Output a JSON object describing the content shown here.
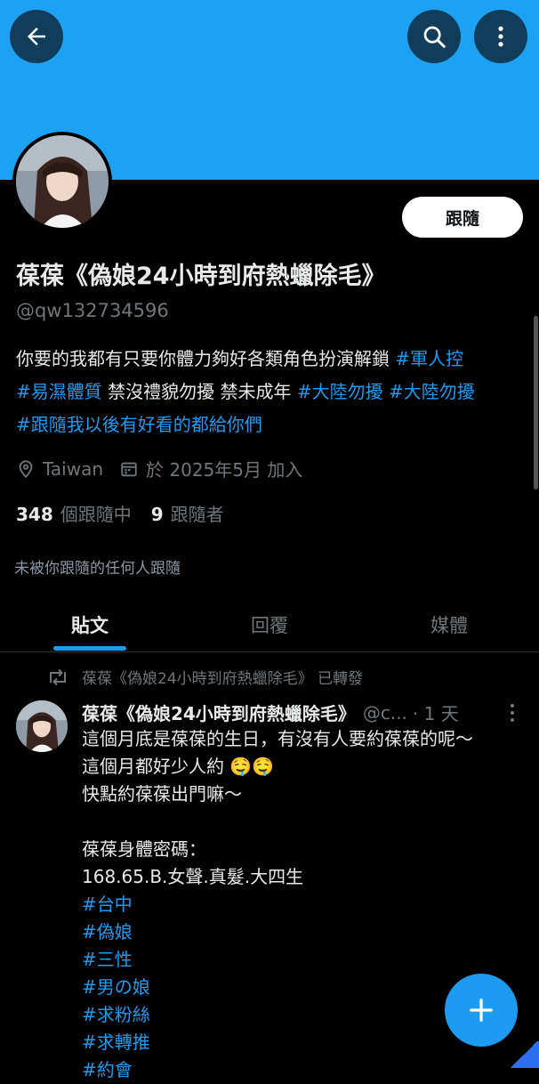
{
  "header": {
    "back_icon": "arrow-left-icon",
    "search_icon": "search-icon",
    "more_icon": "more-vertical-icon",
    "banner_color": "#1da1f2"
  },
  "profile": {
    "follow_label": "跟隨",
    "display_name": "葆葆《偽娘24小時到府熱蠟除毛》",
    "handle": "@qw132734596",
    "bio": {
      "line1_text": "你要的我都有只要你體力夠好各類角色扮演解鎖 ",
      "line1_tag": "#軍人控",
      "line2_tag1": "#易濕體質",
      "line2_text": " 禁沒禮貌勿擾 禁未成年 ",
      "line2_tag2": "#大陸勿擾",
      "line2_tag3": "#大陸勿擾",
      "line3_tag": "#跟隨我以後有好看的都給你們"
    },
    "location": "Taiwan",
    "joined": "於 2025年5月 加入",
    "following_count": "348",
    "following_label": "個跟隨中",
    "followers_count": "9",
    "followers_label": "跟隨者",
    "not_followed_note": "未被你跟隨的任何人跟隨"
  },
  "tabs": [
    {
      "label": "貼文"
    },
    {
      "label": "回覆"
    },
    {
      "label": "媒體"
    }
  ],
  "post": {
    "retweet_label": "葆葆《偽娘24小時到府熱蠟除毛》 已轉發",
    "author_name": "葆葆《偽娘24小時到府熱蠟除毛》",
    "author_handle": "@c...",
    "time": "· 1 天",
    "line1": "這個月底是葆葆的生日，有沒有人要約葆葆的呢～",
    "line2": "這個月都好少人約 🤤🤤",
    "line3": "快點約葆葆出門嘛～",
    "line4": "",
    "line5": "葆葆身體密碼：",
    "line6": "168.65.B.女聲.真髮.大四生",
    "tags": [
      "#台中",
      "#偽娘",
      "#三性",
      "#男の娘",
      "#求粉絲",
      "#求轉推",
      "#約會"
    ]
  },
  "compose": {
    "icon": "plus-icon",
    "accent": "#1d9bf0"
  }
}
